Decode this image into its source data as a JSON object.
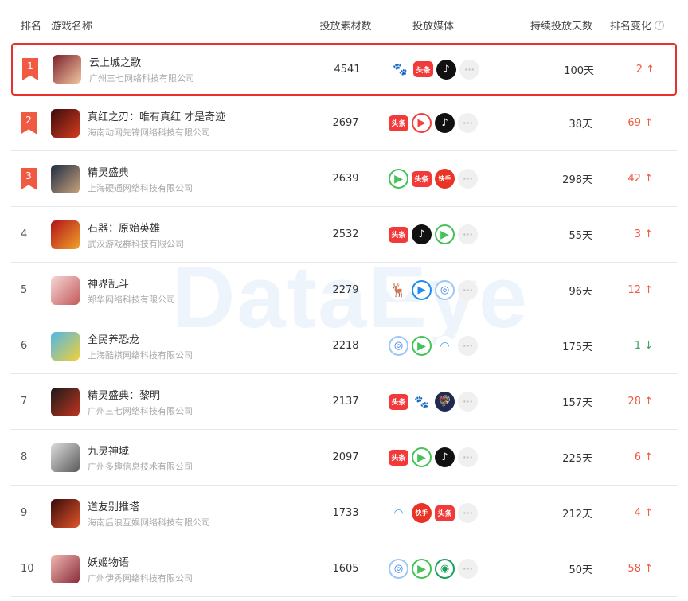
{
  "watermark": "DataEye",
  "header": {
    "rank": "排名",
    "game": "游戏名称",
    "count": "投放素材数",
    "media": "投放媒体",
    "days": "持续投放天数",
    "change": "排名变化",
    "help_icon": "?"
  },
  "colors": {
    "accent_red": "#f05a42",
    "highlight_border": "#e8312f",
    "up": "#f05a42",
    "down": "#3aa55a"
  },
  "rows": [
    {
      "rank": "1",
      "name": "云上城之歌",
      "company": "广州三七网络科技有限公司",
      "count": "4541",
      "days": "100天",
      "change": "2 ↑",
      "direction": "up",
      "media": [
        {
          "icon": "baidu-icon",
          "glyph": "🐾"
        },
        {
          "icon": "toutiao-icon",
          "glyph": "头条"
        },
        {
          "icon": "douyin-icon",
          "glyph": "♪"
        },
        {
          "icon": "more-icon",
          "glyph": "···"
        }
      ]
    },
    {
      "rank": "2",
      "name": "真红之刃：唯有真红 才是奇迹",
      "company": "海南动网先锋网络科技有限公司",
      "count": "2697",
      "days": "38天",
      "change": "69 ↑",
      "direction": "up",
      "media": [
        {
          "icon": "toutiao-icon",
          "glyph": "头条"
        },
        {
          "icon": "xigua-icon",
          "glyph": "▶"
        },
        {
          "icon": "douyin-icon",
          "glyph": "♪"
        },
        {
          "icon": "more-icon",
          "glyph": "···"
        }
      ]
    },
    {
      "rank": "3",
      "name": "精灵盛典",
      "company": "上海硬通网络科技有限公司",
      "count": "2639",
      "days": "298天",
      "change": "42 ↑",
      "direction": "up",
      "media": [
        {
          "icon": "iqiyi-icon",
          "glyph": "▶"
        },
        {
          "icon": "toutiao-icon",
          "glyph": "头条"
        },
        {
          "icon": "kuaishou-icon",
          "glyph": "快手"
        },
        {
          "icon": "more-icon",
          "glyph": "···"
        }
      ]
    },
    {
      "rank": "4",
      "name": "石器：原始英雄",
      "company": "武汉游戏群科技有限公司",
      "count": "2532",
      "days": "55天",
      "change": "3 ↑",
      "direction": "up",
      "media": [
        {
          "icon": "toutiao-icon",
          "glyph": "头条"
        },
        {
          "icon": "douyin-icon",
          "glyph": "♪"
        },
        {
          "icon": "iqiyi-icon",
          "glyph": "▶"
        },
        {
          "icon": "more-icon",
          "glyph": "···"
        }
      ]
    },
    {
      "rank": "5",
      "name": "神界乱斗",
      "company": "郑华网络科技有限公司",
      "count": "2279",
      "days": "96天",
      "change": "12 ↑",
      "direction": "up",
      "media": [
        {
          "icon": "deer-icon",
          "glyph": "🦌"
        },
        {
          "icon": "youku-icon",
          "glyph": "▶"
        },
        {
          "icon": "vivo-icon",
          "glyph": "◎"
        },
        {
          "icon": "more-icon",
          "glyph": "···"
        }
      ]
    },
    {
      "rank": "6",
      "name": "全民养恐龙",
      "company": "上海酷祺网络科技有限公司",
      "count": "2218",
      "days": "175天",
      "change": "1 ↓",
      "direction": "down",
      "media": [
        {
          "icon": "vivo-icon",
          "glyph": "◎"
        },
        {
          "icon": "iqiyi-icon",
          "glyph": "▶"
        },
        {
          "icon": "tencent-icon",
          "glyph": "◠"
        },
        {
          "icon": "more-icon",
          "glyph": "···"
        }
      ]
    },
    {
      "rank": "7",
      "name": "精灵盛典：黎明",
      "company": "广州三七网络科技有限公司",
      "count": "2137",
      "days": "157天",
      "change": "28 ↑",
      "direction": "up",
      "media": [
        {
          "icon": "toutiao-icon",
          "glyph": "头条"
        },
        {
          "icon": "baidu-icon",
          "glyph": "🐾"
        },
        {
          "icon": "ostrich-icon",
          "glyph": "🦃"
        },
        {
          "icon": "more-icon",
          "glyph": "···"
        }
      ]
    },
    {
      "rank": "8",
      "name": "九灵神域",
      "company": "广州多趣信息技术有限公司",
      "count": "2097",
      "days": "225天",
      "change": "6 ↑",
      "direction": "up",
      "media": [
        {
          "icon": "toutiao-icon",
          "glyph": "头条"
        },
        {
          "icon": "iqiyi-icon",
          "glyph": "▶"
        },
        {
          "icon": "douyin-icon",
          "glyph": "♪"
        },
        {
          "icon": "more-icon",
          "glyph": "···"
        }
      ]
    },
    {
      "rank": "9",
      "name": "道友别推塔",
      "company": "海南后浪互娱网络科技有限公司",
      "count": "1733",
      "days": "212天",
      "change": "4 ↑",
      "direction": "up",
      "media": [
        {
          "icon": "tencent-icon",
          "glyph": "◠"
        },
        {
          "icon": "kuaishou-icon",
          "glyph": "快手"
        },
        {
          "icon": "toutiao-icon",
          "glyph": "头条"
        },
        {
          "icon": "more-icon",
          "glyph": "···"
        }
      ]
    },
    {
      "rank": "10",
      "name": "妖姬物语",
      "company": "广州伊秀网络科技有限公司",
      "count": "1605",
      "days": "50天",
      "change": "58 ↑",
      "direction": "up",
      "media": [
        {
          "icon": "vivo-icon",
          "glyph": "◎"
        },
        {
          "icon": "iqiyi-icon",
          "glyph": "▶"
        },
        {
          "icon": "sina-icon",
          "glyph": "◉"
        },
        {
          "icon": "more-icon",
          "glyph": "···"
        }
      ]
    }
  ]
}
